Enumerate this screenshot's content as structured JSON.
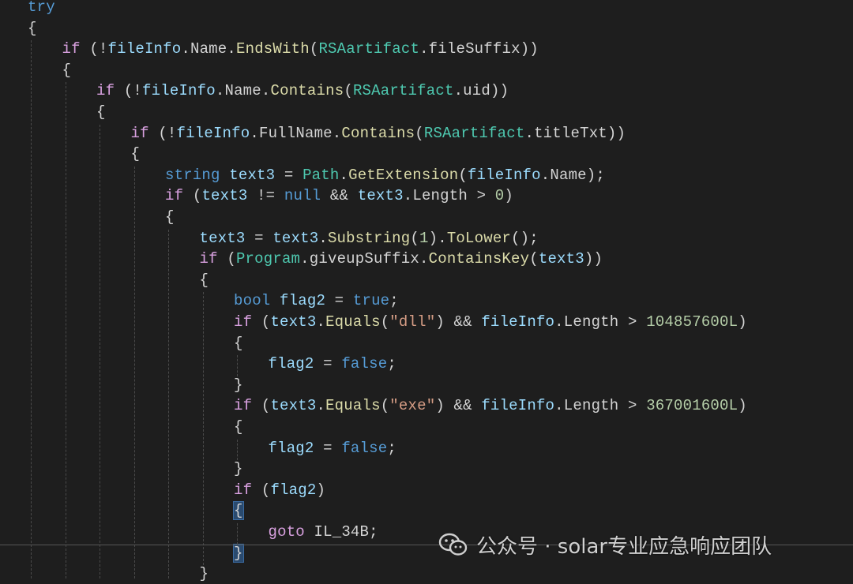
{
  "code": {
    "lines": [
      {
        "indent": 0,
        "tokens": [
          {
            "t": "try",
            "c": "kw"
          }
        ]
      },
      {
        "indent": 0,
        "tokens": [
          {
            "t": "{",
            "c": "punct"
          }
        ]
      },
      {
        "indent": 1,
        "tokens": [
          {
            "t": "if",
            "c": "ctrl"
          },
          {
            "t": " (!",
            "c": "punct"
          },
          {
            "t": "fileInfo",
            "c": "var"
          },
          {
            "t": ".",
            "c": "punct"
          },
          {
            "t": "Name",
            "c": "prop"
          },
          {
            "t": ".",
            "c": "punct"
          },
          {
            "t": "EndsWith",
            "c": "method"
          },
          {
            "t": "(",
            "c": "punct"
          },
          {
            "t": "RSAartifact",
            "c": "type"
          },
          {
            "t": ".",
            "c": "punct"
          },
          {
            "t": "fileSuffix",
            "c": "prop"
          },
          {
            "t": "))",
            "c": "punct"
          }
        ]
      },
      {
        "indent": 1,
        "tokens": [
          {
            "t": "{",
            "c": "punct"
          }
        ]
      },
      {
        "indent": 2,
        "tokens": [
          {
            "t": "if",
            "c": "ctrl"
          },
          {
            "t": " (!",
            "c": "punct"
          },
          {
            "t": "fileInfo",
            "c": "var"
          },
          {
            "t": ".",
            "c": "punct"
          },
          {
            "t": "Name",
            "c": "prop"
          },
          {
            "t": ".",
            "c": "punct"
          },
          {
            "t": "Contains",
            "c": "method"
          },
          {
            "t": "(",
            "c": "punct"
          },
          {
            "t": "RSAartifact",
            "c": "type"
          },
          {
            "t": ".",
            "c": "punct"
          },
          {
            "t": "uid",
            "c": "prop"
          },
          {
            "t": "))",
            "c": "punct"
          }
        ]
      },
      {
        "indent": 2,
        "tokens": [
          {
            "t": "{",
            "c": "punct"
          }
        ]
      },
      {
        "indent": 3,
        "tokens": [
          {
            "t": "if",
            "c": "ctrl"
          },
          {
            "t": " (!",
            "c": "punct"
          },
          {
            "t": "fileInfo",
            "c": "var"
          },
          {
            "t": ".",
            "c": "punct"
          },
          {
            "t": "FullName",
            "c": "prop"
          },
          {
            "t": ".",
            "c": "punct"
          },
          {
            "t": "Contains",
            "c": "method"
          },
          {
            "t": "(",
            "c": "punct"
          },
          {
            "t": "RSAartifact",
            "c": "type"
          },
          {
            "t": ".",
            "c": "punct"
          },
          {
            "t": "titleTxt",
            "c": "prop"
          },
          {
            "t": "))",
            "c": "punct"
          }
        ]
      },
      {
        "indent": 3,
        "tokens": [
          {
            "t": "{",
            "c": "punct"
          }
        ]
      },
      {
        "indent": 4,
        "tokens": [
          {
            "t": "string",
            "c": "kw"
          },
          {
            "t": " ",
            "c": "punct"
          },
          {
            "t": "text3",
            "c": "var"
          },
          {
            "t": " = ",
            "c": "punct"
          },
          {
            "t": "Path",
            "c": "type"
          },
          {
            "t": ".",
            "c": "punct"
          },
          {
            "t": "GetExtension",
            "c": "method"
          },
          {
            "t": "(",
            "c": "punct"
          },
          {
            "t": "fileInfo",
            "c": "var"
          },
          {
            "t": ".",
            "c": "punct"
          },
          {
            "t": "Name",
            "c": "prop"
          },
          {
            "t": ");",
            "c": "punct"
          }
        ]
      },
      {
        "indent": 4,
        "tokens": [
          {
            "t": "if",
            "c": "ctrl"
          },
          {
            "t": " (",
            "c": "punct"
          },
          {
            "t": "text3",
            "c": "var"
          },
          {
            "t": " != ",
            "c": "punct"
          },
          {
            "t": "null",
            "c": "kw"
          },
          {
            "t": " && ",
            "c": "punct"
          },
          {
            "t": "text3",
            "c": "var"
          },
          {
            "t": ".",
            "c": "punct"
          },
          {
            "t": "Length",
            "c": "prop"
          },
          {
            "t": " > ",
            "c": "punct"
          },
          {
            "t": "0",
            "c": "num"
          },
          {
            "t": ")",
            "c": "punct"
          }
        ]
      },
      {
        "indent": 4,
        "tokens": [
          {
            "t": "{",
            "c": "punct"
          }
        ]
      },
      {
        "indent": 5,
        "tokens": [
          {
            "t": "text3",
            "c": "var"
          },
          {
            "t": " = ",
            "c": "punct"
          },
          {
            "t": "text3",
            "c": "var"
          },
          {
            "t": ".",
            "c": "punct"
          },
          {
            "t": "Substring",
            "c": "method"
          },
          {
            "t": "(",
            "c": "punct"
          },
          {
            "t": "1",
            "c": "num"
          },
          {
            "t": ").",
            "c": "punct"
          },
          {
            "t": "ToLower",
            "c": "method"
          },
          {
            "t": "();",
            "c": "punct"
          }
        ]
      },
      {
        "indent": 5,
        "tokens": [
          {
            "t": "if",
            "c": "ctrl"
          },
          {
            "t": " (",
            "c": "punct"
          },
          {
            "t": "Program",
            "c": "type"
          },
          {
            "t": ".",
            "c": "punct"
          },
          {
            "t": "giveupSuffix",
            "c": "prop"
          },
          {
            "t": ".",
            "c": "punct"
          },
          {
            "t": "ContainsKey",
            "c": "method"
          },
          {
            "t": "(",
            "c": "punct"
          },
          {
            "t": "text3",
            "c": "var"
          },
          {
            "t": "))",
            "c": "punct"
          }
        ]
      },
      {
        "indent": 5,
        "tokens": [
          {
            "t": "{",
            "c": "punct"
          }
        ]
      },
      {
        "indent": 6,
        "tokens": [
          {
            "t": "bool",
            "c": "kw"
          },
          {
            "t": " ",
            "c": "punct"
          },
          {
            "t": "flag2",
            "c": "var"
          },
          {
            "t": " = ",
            "c": "punct"
          },
          {
            "t": "true",
            "c": "kw"
          },
          {
            "t": ";",
            "c": "punct"
          }
        ]
      },
      {
        "indent": 6,
        "tokens": [
          {
            "t": "if",
            "c": "ctrl"
          },
          {
            "t": " (",
            "c": "punct"
          },
          {
            "t": "text3",
            "c": "var"
          },
          {
            "t": ".",
            "c": "punct"
          },
          {
            "t": "Equals",
            "c": "method"
          },
          {
            "t": "(",
            "c": "punct"
          },
          {
            "t": "\"dll\"",
            "c": "str"
          },
          {
            "t": ") && ",
            "c": "punct"
          },
          {
            "t": "fileInfo",
            "c": "var"
          },
          {
            "t": ".",
            "c": "punct"
          },
          {
            "t": "Length",
            "c": "prop"
          },
          {
            "t": " > ",
            "c": "punct"
          },
          {
            "t": "104857600L",
            "c": "num"
          },
          {
            "t": ")",
            "c": "punct"
          }
        ]
      },
      {
        "indent": 6,
        "tokens": [
          {
            "t": "{",
            "c": "punct"
          }
        ]
      },
      {
        "indent": 7,
        "tokens": [
          {
            "t": "flag2",
            "c": "var"
          },
          {
            "t": " = ",
            "c": "punct"
          },
          {
            "t": "false",
            "c": "kw"
          },
          {
            "t": ";",
            "c": "punct"
          }
        ]
      },
      {
        "indent": 6,
        "tokens": [
          {
            "t": "}",
            "c": "punct"
          }
        ]
      },
      {
        "indent": 6,
        "tokens": [
          {
            "t": "if",
            "c": "ctrl"
          },
          {
            "t": " (",
            "c": "punct"
          },
          {
            "t": "text3",
            "c": "var"
          },
          {
            "t": ".",
            "c": "punct"
          },
          {
            "t": "Equals",
            "c": "method"
          },
          {
            "t": "(",
            "c": "punct"
          },
          {
            "t": "\"exe\"",
            "c": "str"
          },
          {
            "t": ") && ",
            "c": "punct"
          },
          {
            "t": "fileInfo",
            "c": "var"
          },
          {
            "t": ".",
            "c": "punct"
          },
          {
            "t": "Length",
            "c": "prop"
          },
          {
            "t": " > ",
            "c": "punct"
          },
          {
            "t": "367001600L",
            "c": "num"
          },
          {
            "t": ")",
            "c": "punct"
          }
        ]
      },
      {
        "indent": 6,
        "tokens": [
          {
            "t": "{",
            "c": "punct"
          }
        ]
      },
      {
        "indent": 7,
        "tokens": [
          {
            "t": "flag2",
            "c": "var"
          },
          {
            "t": " = ",
            "c": "punct"
          },
          {
            "t": "false",
            "c": "kw"
          },
          {
            "t": ";",
            "c": "punct"
          }
        ]
      },
      {
        "indent": 6,
        "tokens": [
          {
            "t": "}",
            "c": "punct"
          }
        ]
      },
      {
        "indent": 6,
        "tokens": [
          {
            "t": "if",
            "c": "ctrl"
          },
          {
            "t": " (",
            "c": "punct"
          },
          {
            "t": "flag2",
            "c": "var"
          },
          {
            "t": ")",
            "c": "punct"
          }
        ]
      },
      {
        "indent": 6,
        "tokens": [
          {
            "t": "{",
            "c": "punct",
            "hl": true
          }
        ]
      },
      {
        "indent": 7,
        "tokens": [
          {
            "t": "goto",
            "c": "ctrl"
          },
          {
            "t": " IL_34B;",
            "c": "label"
          }
        ]
      },
      {
        "indent": 6,
        "tokens": [
          {
            "t": "}",
            "c": "punct",
            "hl": true
          }
        ]
      },
      {
        "indent": 5,
        "tokens": [
          {
            "t": "}",
            "c": "punct"
          }
        ]
      }
    ]
  },
  "watermark": {
    "icon": "wechat-icon",
    "text": "公众号 · solar专业应急响应团队"
  },
  "colors": {
    "background": "#1e1e1e",
    "keyword": "#569cd6",
    "control": "#d8a0df",
    "type": "#4ec9b0",
    "variable": "#9cdcfe",
    "method": "#dcdcaa",
    "string": "#d69d85",
    "number": "#b5cea8"
  }
}
